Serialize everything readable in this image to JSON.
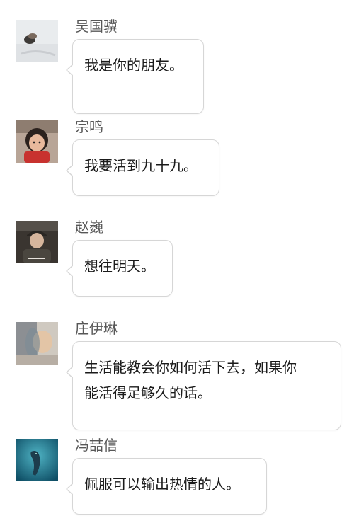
{
  "messages": [
    {
      "name": "吴国骥",
      "text": "我是你的朋友。",
      "avatar_icon": "person-holding-object-avatar"
    },
    {
      "name": "宗鸣",
      "text": "我要活到九十九。",
      "avatar_icon": "child-in-red-avatar"
    },
    {
      "name": "赵巍",
      "text": "想往明天。",
      "avatar_icon": "man-in-cap-avatar"
    },
    {
      "name": "庄伊琳",
      "text": "生活能教会你如何活下去，如果你\n能活得足够久的话。",
      "avatar_icon": "blurred-portrait-avatar"
    },
    {
      "name": "冯喆信",
      "text": "佩服可以输出热情的人。",
      "avatar_icon": "dolphin-avatar"
    }
  ]
}
